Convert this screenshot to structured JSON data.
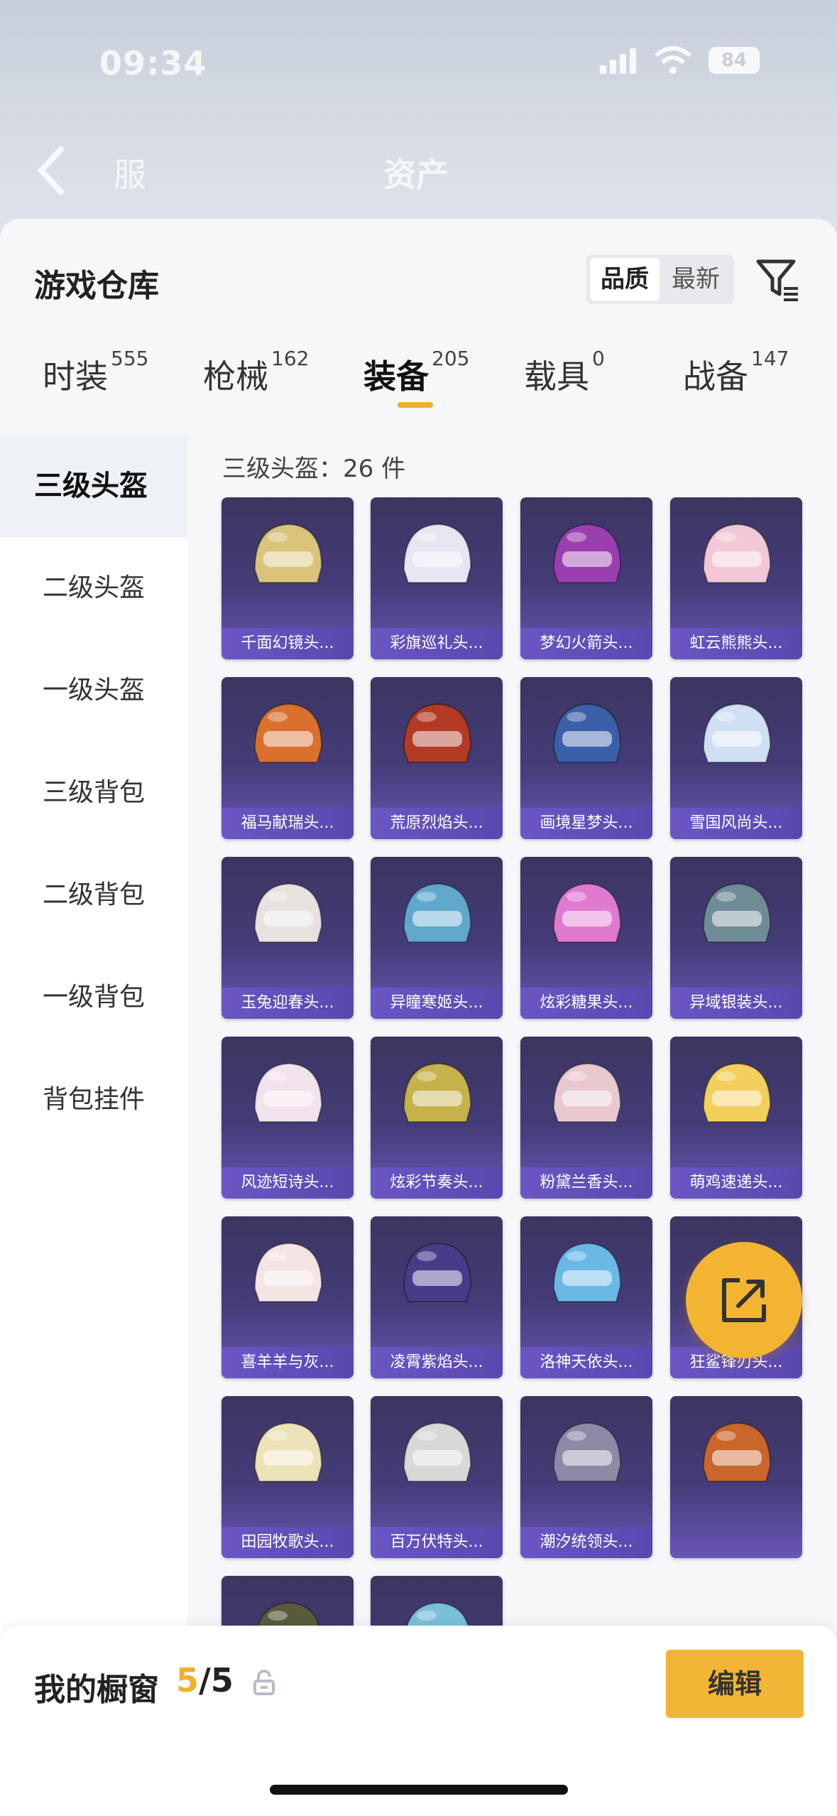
{
  "status_bar": {
    "time": "09:34",
    "battery": "84"
  },
  "page_tabs_background": [
    "服",
    "资产"
  ],
  "sheet": {
    "title": "游戏仓库",
    "sort": {
      "options": [
        "品质",
        "最新"
      ],
      "selected": "品质"
    }
  },
  "categories": [
    {
      "label": "时装",
      "count": "555"
    },
    {
      "label": "枪械",
      "count": "162"
    },
    {
      "label": "装备",
      "count": "205",
      "active": true
    },
    {
      "label": "载具",
      "count": "0"
    },
    {
      "label": "战备",
      "count": "147"
    }
  ],
  "sidebar": {
    "items": [
      "三级头盔",
      "二级头盔",
      "一级头盔",
      "三级背包",
      "二级背包",
      "一级背包",
      "背包挂件"
    ],
    "selected": "三级头盔"
  },
  "grid": {
    "header": "三级头盔：26 件",
    "items": [
      {
        "name": "千面幻镜头...",
        "color": "#d9c47a"
      },
      {
        "name": "彩旗巡礼头...",
        "color": "#e9e4f2"
      },
      {
        "name": "梦幻火箭头...",
        "color": "#9b3fb0"
      },
      {
        "name": "虹云熊熊头...",
        "color": "#f2c8d8"
      },
      {
        "name": "福马献瑞头...",
        "color": "#d9702e"
      },
      {
        "name": "荒原烈焰头...",
        "color": "#b33a24"
      },
      {
        "name": "画境星梦头...",
        "color": "#3b5fa8"
      },
      {
        "name": "雪国风尚头...",
        "color": "#cfe0f2"
      },
      {
        "name": "玉兔迎春头...",
        "color": "#e7e1e0"
      },
      {
        "name": "异瞳寒姬头...",
        "color": "#5fa8cc"
      },
      {
        "name": "炫彩糖果头...",
        "color": "#e07ad0"
      },
      {
        "name": "异域银装头...",
        "color": "#6f8c96"
      },
      {
        "name": "风迹短诗头...",
        "color": "#f1e2ec"
      },
      {
        "name": "炫彩节奏头...",
        "color": "#c6b24a"
      },
      {
        "name": "粉黛兰香头...",
        "color": "#e9c9cf"
      },
      {
        "name": "萌鸡速递头...",
        "color": "#f3cf5c"
      },
      {
        "name": "喜羊羊与灰...",
        "color": "#f4e4e4"
      },
      {
        "name": "凌霄紫焰头...",
        "color": "#4a3a8a"
      },
      {
        "name": "洛神天依头...",
        "color": "#6ab8e6"
      },
      {
        "name": "狂鲨锋刃头...",
        "color": "#2c2c34"
      },
      {
        "name": "田园牧歌头...",
        "color": "#ece3b8"
      },
      {
        "name": "百万伏特头...",
        "color": "#d8d8d8"
      },
      {
        "name": "潮汐统领头...",
        "color": "#8c8aa6"
      },
      {
        "name": "",
        "color": "#c9662c"
      },
      {
        "name": "",
        "color": "#5a5a3c"
      },
      {
        "name": "",
        "color": "#7ac0d8"
      }
    ]
  },
  "showcase": {
    "title": "我的橱窗",
    "used": "5",
    "total": "/5",
    "edit_label": "编辑"
  },
  "colors": {
    "accent": "#f0b02c",
    "card_top": "#3b3560",
    "card_bottom": "#6a56b8"
  }
}
